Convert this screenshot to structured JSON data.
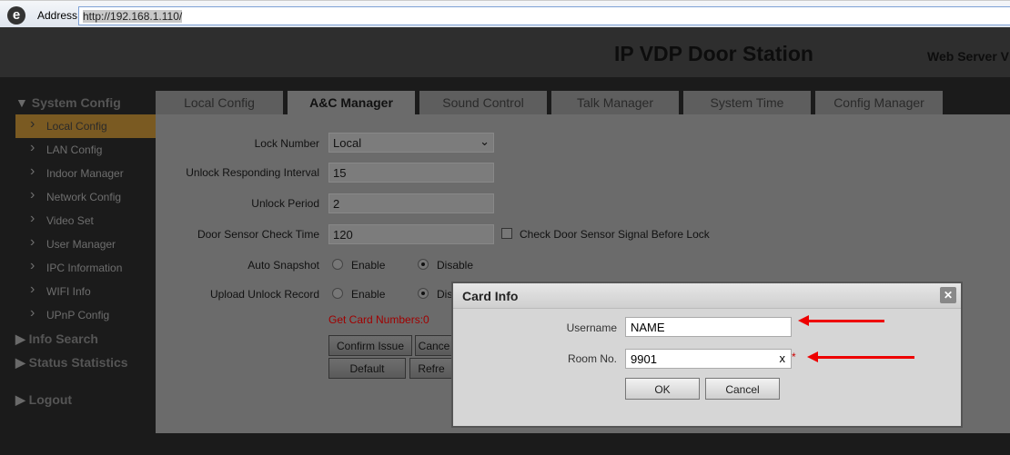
{
  "browser": {
    "address_label": "Address:",
    "url": "http://192.168.1.110/"
  },
  "header": {
    "title": "IP VDP Door Station",
    "web_server": "Web Server V"
  },
  "sidebar": {
    "sections": [
      {
        "label": "System Config"
      },
      {
        "label": "Info Search"
      },
      {
        "label": "Status Statistics"
      },
      {
        "label": "Logout"
      }
    ],
    "items": [
      {
        "label": "Local Config",
        "active": true
      },
      {
        "label": "LAN Config"
      },
      {
        "label": "Indoor Manager"
      },
      {
        "label": "Network Config"
      },
      {
        "label": "Video Set"
      },
      {
        "label": "User Manager"
      },
      {
        "label": "IPC Information"
      },
      {
        "label": "WIFI Info"
      },
      {
        "label": "UPnP Config"
      }
    ]
  },
  "tabs": [
    {
      "label": "Local Config"
    },
    {
      "label": "A&C Manager",
      "active": true
    },
    {
      "label": "Sound Control"
    },
    {
      "label": "Talk Manager"
    },
    {
      "label": "System Time"
    },
    {
      "label": "Config Manager"
    }
  ],
  "form": {
    "lock_number": {
      "label": "Lock Number",
      "value": "Local"
    },
    "unlock_interval": {
      "label": "Unlock Responding Interval",
      "value": "15"
    },
    "unlock_period": {
      "label": "Unlock Period",
      "value": "2"
    },
    "door_sensor": {
      "label": "Door Sensor Check Time",
      "value": "120",
      "checkbox_label": "Check Door Sensor Signal Before Lock",
      "checked": false
    },
    "auto_snapshot": {
      "label": "Auto Snapshot",
      "enable": "Enable",
      "disable": "Disable",
      "selected": "Disable"
    },
    "upload_unlock": {
      "label": "Upload Unlock Record",
      "enable": "Enable",
      "disable": "Dis",
      "selected": "Disable"
    },
    "card_numbers": "Get Card Numbers:0",
    "buttons": {
      "confirm": "Confirm Issue",
      "cancel": "Cance",
      "default": "Default",
      "refresh": "Refre"
    }
  },
  "modal": {
    "title": "Card Info",
    "close": "✕",
    "username_label": "Username",
    "username": "NAME",
    "room_label": "Room No.",
    "room": "9901",
    "clear": "x",
    "required": "*",
    "ok": "OK",
    "cancel": "Cancel"
  },
  "colors": {
    "accent": "#7a5a22",
    "error": "#b00000",
    "arrow": "#e00000"
  }
}
